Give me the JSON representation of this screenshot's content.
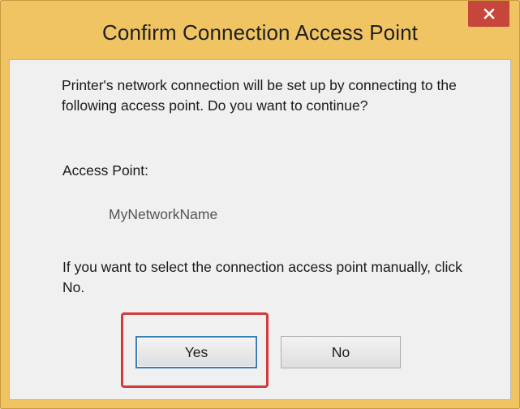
{
  "dialog": {
    "title": "Confirm Connection Access Point",
    "close_icon": "close-icon",
    "message": "Printer's network connection will be set up by connecting to the following access point. Do you want to continue?",
    "access_point_label": "Access Point:",
    "access_point_value": "MyNetworkName",
    "manual_message": "If you want to select the connection access point manually, click No.",
    "yes_label": "Yes",
    "no_label": "No"
  },
  "colors": {
    "title_bar": "#f0c462",
    "close_button": "#c7463b",
    "highlight": "#d33a3a",
    "client_background": "#f0f0f0"
  }
}
